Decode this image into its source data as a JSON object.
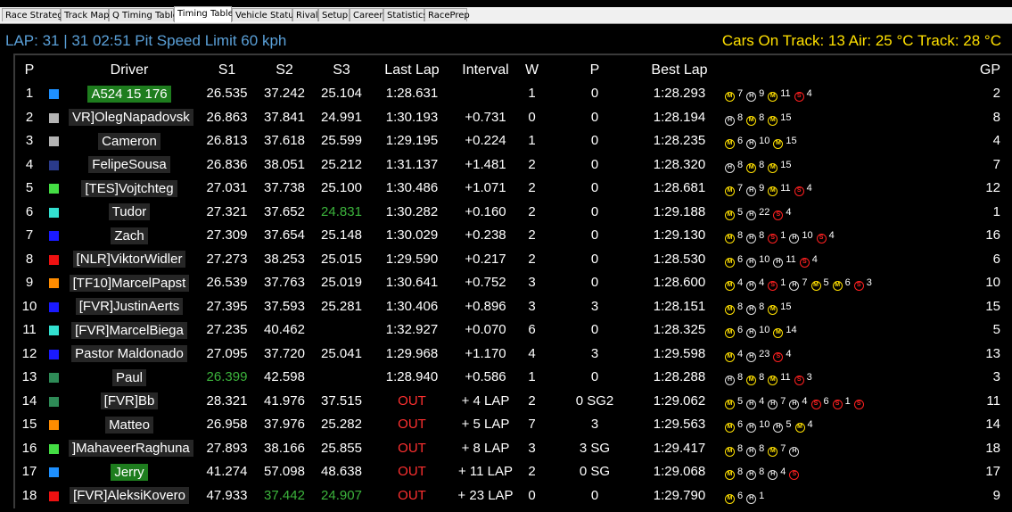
{
  "tabs": [
    {
      "label": "Race Strategy",
      "active": false
    },
    {
      "label": "Track Map",
      "active": false
    },
    {
      "label": "Q Timing Table",
      "active": false
    },
    {
      "label": "Timing Table",
      "active": true
    },
    {
      "label": "Vehicle Status",
      "active": false
    },
    {
      "label": "Rival",
      "active": false
    },
    {
      "label": "Setup",
      "active": false
    },
    {
      "label": "Career",
      "active": false
    },
    {
      "label": "Statistics",
      "active": false
    },
    {
      "label": "RacePrep",
      "active": false
    }
  ],
  "status": {
    "left": "LAP: 31 | 31  02:51 Pit Speed Limit 60 kph",
    "right": "Cars On Track: 13 Air: 25 °C Track: 28 °C"
  },
  "columns": [
    "P",
    "Driver",
    "S1",
    "S2",
    "S3",
    "Last Lap",
    "Interval",
    "W",
    "P",
    "Best Lap",
    "GP"
  ],
  "tyre_glyphs": {
    "M": "M",
    "H": "H",
    "S": "S"
  },
  "colors": {
    "accent_blue": "#5aa0d8",
    "header_yellow": "#ffe000",
    "out_red": "#ff3030",
    "fast_green": "#3cb43c",
    "highlight_green": "#1e7d1e"
  },
  "rows": [
    {
      "pos": "1",
      "color": "#1e90ff",
      "driver": "A524 15 176",
      "hl": true,
      "s1": "26.535",
      "s2": "37.242",
      "s3": "25.104",
      "last": "1:28.631",
      "interval": "",
      "w": "1",
      "p": "0",
      "best": "1:28.293",
      "gp": "2",
      "stints": [
        [
          "M",
          "7"
        ],
        [
          "H",
          "9"
        ],
        [
          "M",
          "11"
        ],
        [
          "S",
          "4"
        ]
      ]
    },
    {
      "pos": "2",
      "color": "#b4b4b4",
      "driver": "VR]OlegNapadovsk",
      "s1": "26.863",
      "s2": "37.841",
      "s3": "24.991",
      "last": "1:30.193",
      "interval": "+0.731",
      "w": "0",
      "p": "0",
      "best": "1:28.194",
      "gp": "8",
      "stints": [
        [
          "H",
          "8"
        ],
        [
          "M",
          "8"
        ],
        [
          "M",
          "15"
        ]
      ]
    },
    {
      "pos": "3",
      "color": "#b4b4b4",
      "driver": "Cameron",
      "s1": "26.813",
      "s2": "37.618",
      "s3": "25.599",
      "last": "1:29.195",
      "interval": "+0.224",
      "w": "1",
      "p": "0",
      "best": "1:28.235",
      "gp": "4",
      "stints": [
        [
          "M",
          "6"
        ],
        [
          "H",
          "10"
        ],
        [
          "M",
          "15"
        ]
      ]
    },
    {
      "pos": "4",
      "color": "#2a3a8a",
      "driver": "FelipeSousa",
      "s1": "26.836",
      "s2": "38.051",
      "s3": "25.212",
      "last": "1:31.137",
      "interval": "+1.481",
      "w": "2",
      "p": "0",
      "best": "1:28.320",
      "gp": "7",
      "stints": [
        [
          "H",
          "8"
        ],
        [
          "M",
          "8"
        ],
        [
          "M",
          "15"
        ]
      ]
    },
    {
      "pos": "5",
      "color": "#44dd44",
      "driver": "[TES]Vojtchteg",
      "s1": "27.031",
      "s2": "37.738",
      "s3": "25.100",
      "last": "1:30.486",
      "interval": "+1.071",
      "w": "2",
      "p": "0",
      "best": "1:28.681",
      "gp": "12",
      "stints": [
        [
          "M",
          "7"
        ],
        [
          "H",
          "9"
        ],
        [
          "M",
          "11"
        ],
        [
          "S",
          "4"
        ]
      ]
    },
    {
      "pos": "6",
      "color": "#33e0d0",
      "driver": "Tudor",
      "s1": "27.321",
      "s2": "37.652",
      "s3": "24.831",
      "s3g": true,
      "last": "1:30.282",
      "interval": "+0.160",
      "w": "2",
      "p": "0",
      "best": "1:29.188",
      "gp": "1",
      "stints": [
        [
          "M",
          "5"
        ],
        [
          "H",
          "22"
        ],
        [
          "S",
          "4"
        ]
      ]
    },
    {
      "pos": "7",
      "color": "#1a1aff",
      "driver": "Zach",
      "s1": "27.309",
      "s2": "37.654",
      "s3": "25.148",
      "last": "1:30.029",
      "interval": "+0.238",
      "w": "2",
      "p": "0",
      "best": "1:29.130",
      "gp": "16",
      "stints": [
        [
          "M",
          "8"
        ],
        [
          "H",
          "8"
        ],
        [
          "S",
          "1"
        ],
        [
          "H",
          "10"
        ],
        [
          "S",
          "4"
        ]
      ]
    },
    {
      "pos": "8",
      "color": "#ee1111",
      "driver": "[NLR]ViktorWidler",
      "s1": "27.273",
      "s2": "38.253",
      "s3": "25.015",
      "last": "1:29.590",
      "interval": "+0.217",
      "w": "2",
      "p": "0",
      "best": "1:28.530",
      "gp": "6",
      "stints": [
        [
          "M",
          "6"
        ],
        [
          "H",
          "10"
        ],
        [
          "H",
          "11"
        ],
        [
          "S",
          "4"
        ]
      ]
    },
    {
      "pos": "9",
      "color": "#ff8c00",
      "driver": "[TF10]MarcelPapst",
      "s1": "26.539",
      "s2": "37.763",
      "s3": "25.019",
      "last": "1:30.641",
      "interval": "+0.752",
      "w": "3",
      "p": "0",
      "best": "1:28.600",
      "gp": "10",
      "stints": [
        [
          "M",
          "4"
        ],
        [
          "H",
          "4"
        ],
        [
          "S",
          "1"
        ],
        [
          "H",
          "7"
        ],
        [
          "M",
          "5"
        ],
        [
          "M",
          "6"
        ],
        [
          "S",
          "3"
        ]
      ]
    },
    {
      "pos": "10",
      "color": "#1a1aff",
      "driver": "[FVR]JustinAerts",
      "s1": "27.395",
      "s2": "37.593",
      "s3": "25.281",
      "last": "1:30.406",
      "interval": "+0.896",
      "w": "3",
      "p": "3",
      "best": "1:28.151",
      "gp": "15",
      "stints": [
        [
          "M",
          "8"
        ],
        [
          "H",
          "8"
        ],
        [
          "M",
          "15"
        ]
      ]
    },
    {
      "pos": "11",
      "color": "#33e0d0",
      "driver": "[FVR]MarcelBiega",
      "s1": "27.235",
      "s2": "40.462",
      "s3": "",
      "last": "1:32.927",
      "interval": "+0.070",
      "w": "6",
      "p": "0",
      "best": "1:28.325",
      "gp": "5",
      "stints": [
        [
          "M",
          "6"
        ],
        [
          "H",
          "10"
        ],
        [
          "M",
          "14"
        ]
      ]
    },
    {
      "pos": "12",
      "color": "#1a1aff",
      "driver": "Pastor Maldonado",
      "s1": "27.095",
      "s2": "37.720",
      "s3": "25.041",
      "last": "1:29.968",
      "interval": "+1.170",
      "w": "4",
      "p": "3",
      "best": "1:29.598",
      "gp": "13",
      "stints": [
        [
          "M",
          "4"
        ],
        [
          "H",
          "23"
        ],
        [
          "S",
          "4"
        ]
      ]
    },
    {
      "pos": "13",
      "color": "#2e8b57",
      "driver": "Paul",
      "s1": "26.399",
      "s1g": true,
      "s2": "42.598",
      "s3": "",
      "last": "1:28.940",
      "interval": "+0.586",
      "w": "1",
      "p": "0",
      "best": "1:28.288",
      "gp": "3",
      "stints": [
        [
          "H",
          "8"
        ],
        [
          "M",
          "8"
        ],
        [
          "M",
          "11"
        ],
        [
          "S",
          "3"
        ]
      ]
    },
    {
      "pos": "14",
      "color": "#2e8b57",
      "driver": "[FVR]Bb",
      "s1": "28.321",
      "s2": "41.976",
      "s3": "37.515",
      "last": "OUT",
      "interval": "+ 4 LAP",
      "w": "2",
      "p": "0 SG2",
      "best": "1:29.062",
      "gp": "11",
      "stints": [
        [
          "M",
          "5"
        ],
        [
          "H",
          "4"
        ],
        [
          "H",
          "7"
        ],
        [
          "H",
          "4"
        ],
        [
          "S",
          "6"
        ],
        [
          "S",
          "1"
        ],
        [
          "S",
          ""
        ]
      ]
    },
    {
      "pos": "15",
      "color": "#ff8c00",
      "driver": "Matteo",
      "s1": "26.958",
      "s2": "37.976",
      "s3": "25.282",
      "last": "OUT",
      "interval": "+ 5 LAP",
      "w": "7",
      "p": "3",
      "best": "1:29.563",
      "gp": "14",
      "stints": [
        [
          "M",
          "6"
        ],
        [
          "H",
          "10"
        ],
        [
          "H",
          "5"
        ],
        [
          "M",
          "4"
        ]
      ]
    },
    {
      "pos": "16",
      "color": "#44dd44",
      "driver": "]MahaveerRaghuna",
      "s1": "27.893",
      "s2": "38.166",
      "s3": "25.855",
      "last": "OUT",
      "interval": "+ 8 LAP",
      "w": "3",
      "p": "3 SG",
      "best": "1:29.417",
      "gp": "18",
      "stints": [
        [
          "M",
          "8"
        ],
        [
          "H",
          "8"
        ],
        [
          "M",
          "7"
        ],
        [
          "H",
          ""
        ]
      ]
    },
    {
      "pos": "17",
      "color": "#1e90ff",
      "driver": "Jerry",
      "hl": true,
      "s1": "41.274",
      "s2": "57.098",
      "s3": "48.638",
      "last": "OUT",
      "interval": "+ 11 LAP",
      "w": "2",
      "p": "0 SG",
      "best": "1:29.068",
      "gp": "17",
      "stints": [
        [
          "M",
          "8"
        ],
        [
          "H",
          "8"
        ],
        [
          "H",
          "4"
        ],
        [
          "S",
          ""
        ]
      ]
    },
    {
      "pos": "18",
      "color": "#ee1111",
      "driver": "[FVR]AleksiKovero",
      "s1": "47.933",
      "s2": "37.442",
      "s2g": true,
      "s3": "24.907",
      "s3g": true,
      "last": "OUT",
      "interval": "+ 23 LAP",
      "w": "0",
      "p": "0",
      "best": "1:29.790",
      "gp": "9",
      "stints": [
        [
          "M",
          "6"
        ],
        [
          "H",
          "1"
        ]
      ]
    }
  ]
}
